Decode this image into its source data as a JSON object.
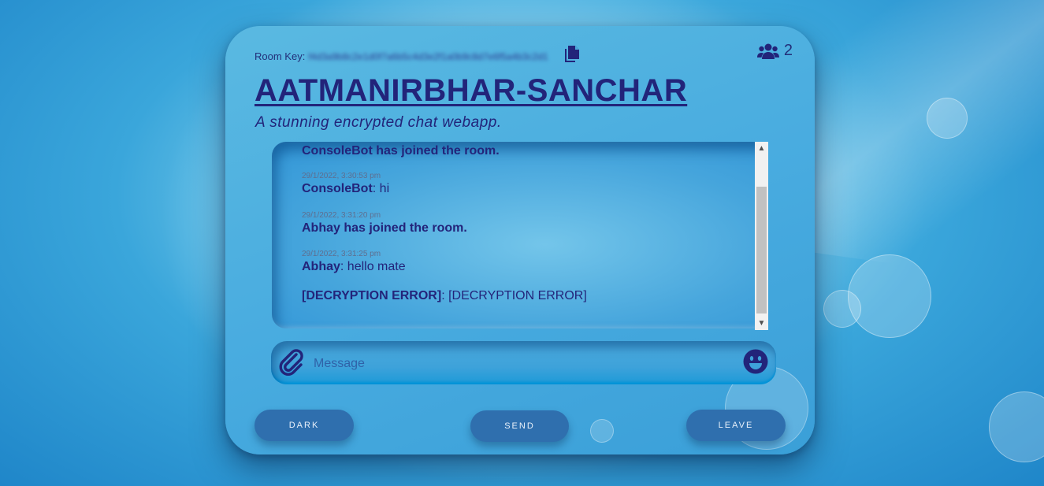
{
  "header": {
    "room_key_label": "Room Key:",
    "room_key_value": "f4d3a9b8c2e1d0f7a6b5c4d3e2f1a0b9c8d7e6f5a4b3c2d1",
    "copy_icon": "copy-icon",
    "users_icon": "users-icon",
    "user_count": "2"
  },
  "title": "AATMANIRBHAR-SANCHAR",
  "subtitle": "A stunning encrypted chat webapp.",
  "messages": [
    {
      "timestamp": "",
      "sender": "ConsoleBot has joined the room.",
      "text": ""
    },
    {
      "timestamp": "29/1/2022, 3:30:53 pm",
      "sender": "ConsoleBot",
      "text": ": hi"
    },
    {
      "timestamp": "29/1/2022, 3:31:20 pm",
      "sender": "Abhay has joined the room.",
      "text": ""
    },
    {
      "timestamp": "29/1/2022, 3:31:25 pm",
      "sender": "Abhay",
      "text": ": hello mate"
    },
    {
      "timestamp": "",
      "sender": "[DECRYPTION ERROR]",
      "text": ": [DECRYPTION ERROR]"
    }
  ],
  "scrollbar": {
    "up": "▲",
    "down": "▼"
  },
  "input": {
    "attach_icon": "paperclip-icon",
    "placeholder": "Message",
    "value": "",
    "emoji_icon": "smiley-icon"
  },
  "buttons": {
    "dark": "DARK",
    "send": "SEND",
    "leave": "LEAVE"
  },
  "colors": {
    "accent": "#22247a",
    "button": "#2f6fae",
    "card": "#49ace0"
  }
}
